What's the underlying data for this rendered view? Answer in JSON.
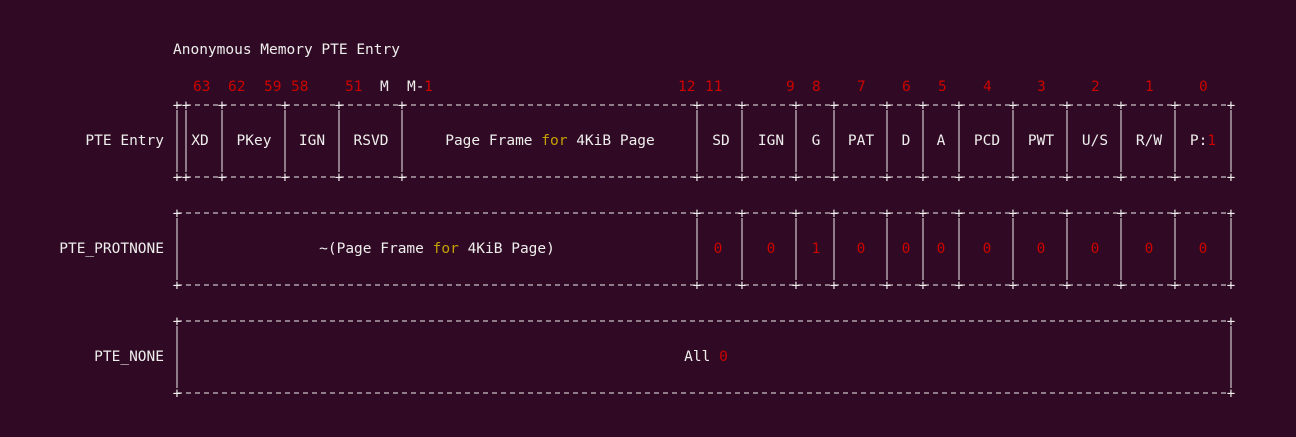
{
  "diagram": {
    "title": "Anonymous Memory PTE Entry",
    "bit_labels": [
      {
        "text": "63",
        "color": "red"
      },
      {
        "text": "62",
        "color": "red"
      },
      {
        "text": "59",
        "color": "red"
      },
      {
        "text": "58",
        "color": "red"
      },
      {
        "text": "51",
        "color": "red"
      },
      {
        "text": "M",
        "color": "white"
      },
      {
        "text": "M-",
        "color": "white"
      },
      {
        "text": "1",
        "color": "red"
      },
      {
        "text": "12",
        "color": "red"
      },
      {
        "text": "11",
        "color": "red"
      },
      {
        "text": "9",
        "color": "red"
      },
      {
        "text": "8",
        "color": "red"
      },
      {
        "text": "7",
        "color": "red"
      },
      {
        "text": "6",
        "color": "red"
      },
      {
        "text": "5",
        "color": "red"
      },
      {
        "text": "4",
        "color": "red"
      },
      {
        "text": "3",
        "color": "red"
      },
      {
        "text": "2",
        "color": "red"
      },
      {
        "text": "1",
        "color": "red"
      },
      {
        "text": "0",
        "color": "red"
      }
    ],
    "rows": [
      {
        "label": "PTE Entry",
        "fields": [
          {
            "parts": [
              {
                "t": "XD",
                "c": "white"
              }
            ]
          },
          {
            "parts": [
              {
                "t": "PKey",
                "c": "white"
              }
            ]
          },
          {
            "parts": [
              {
                "t": "IGN",
                "c": "white"
              }
            ]
          },
          {
            "parts": [
              {
                "t": "RSVD",
                "c": "white"
              }
            ]
          },
          {
            "parts": [
              {
                "t": "Page Frame ",
                "c": "white"
              },
              {
                "t": "for",
                "c": "kw"
              },
              {
                "t": " 4KiB Page",
                "c": "white"
              }
            ]
          },
          {
            "parts": [
              {
                "t": "SD",
                "c": "white"
              }
            ]
          },
          {
            "parts": [
              {
                "t": "IGN",
                "c": "white"
              }
            ]
          },
          {
            "parts": [
              {
                "t": "G",
                "c": "white"
              }
            ]
          },
          {
            "parts": [
              {
                "t": "PAT",
                "c": "white"
              }
            ]
          },
          {
            "parts": [
              {
                "t": "D",
                "c": "white"
              }
            ]
          },
          {
            "parts": [
              {
                "t": "A",
                "c": "white"
              }
            ]
          },
          {
            "parts": [
              {
                "t": "PCD",
                "c": "white"
              }
            ]
          },
          {
            "parts": [
              {
                "t": "PWT",
                "c": "white"
              }
            ]
          },
          {
            "parts": [
              {
                "t": "U/S",
                "c": "white"
              }
            ]
          },
          {
            "parts": [
              {
                "t": "R/W",
                "c": "white"
              }
            ]
          },
          {
            "parts": [
              {
                "t": "P:",
                "c": "white"
              },
              {
                "t": "1",
                "c": "red"
              }
            ]
          }
        ]
      },
      {
        "label": "PTE_PROTNONE",
        "fields": [
          {
            "parts": [
              {
                "t": "~(Page Frame ",
                "c": "white"
              },
              {
                "t": "for",
                "c": "kw"
              },
              {
                "t": " 4KiB Page)",
                "c": "white"
              }
            ]
          },
          {
            "parts": [
              {
                "t": "0",
                "c": "red"
              }
            ]
          },
          {
            "parts": [
              {
                "t": "0",
                "c": "red"
              }
            ]
          },
          {
            "parts": [
              {
                "t": "1",
                "c": "red"
              }
            ]
          },
          {
            "parts": [
              {
                "t": "0",
                "c": "red"
              }
            ]
          },
          {
            "parts": [
              {
                "t": "0",
                "c": "red"
              }
            ]
          },
          {
            "parts": [
              {
                "t": "0",
                "c": "red"
              }
            ]
          },
          {
            "parts": [
              {
                "t": "0",
                "c": "red"
              }
            ]
          },
          {
            "parts": [
              {
                "t": "0",
                "c": "red"
              }
            ]
          },
          {
            "parts": [
              {
                "t": "0",
                "c": "red"
              }
            ]
          },
          {
            "parts": [
              {
                "t": "0",
                "c": "red"
              }
            ]
          },
          {
            "parts": [
              {
                "t": "0",
                "c": "red"
              }
            ]
          }
        ]
      },
      {
        "label": "PTE_NONE",
        "fields": [
          {
            "parts": [
              {
                "t": "All ",
                "c": "white"
              },
              {
                "t": "0",
                "c": "red"
              }
            ]
          }
        ]
      }
    ],
    "colors": {
      "background": "#300a24",
      "white": "#eeeeec",
      "red": "#cc0000",
      "kw": "#c4a000"
    }
  }
}
